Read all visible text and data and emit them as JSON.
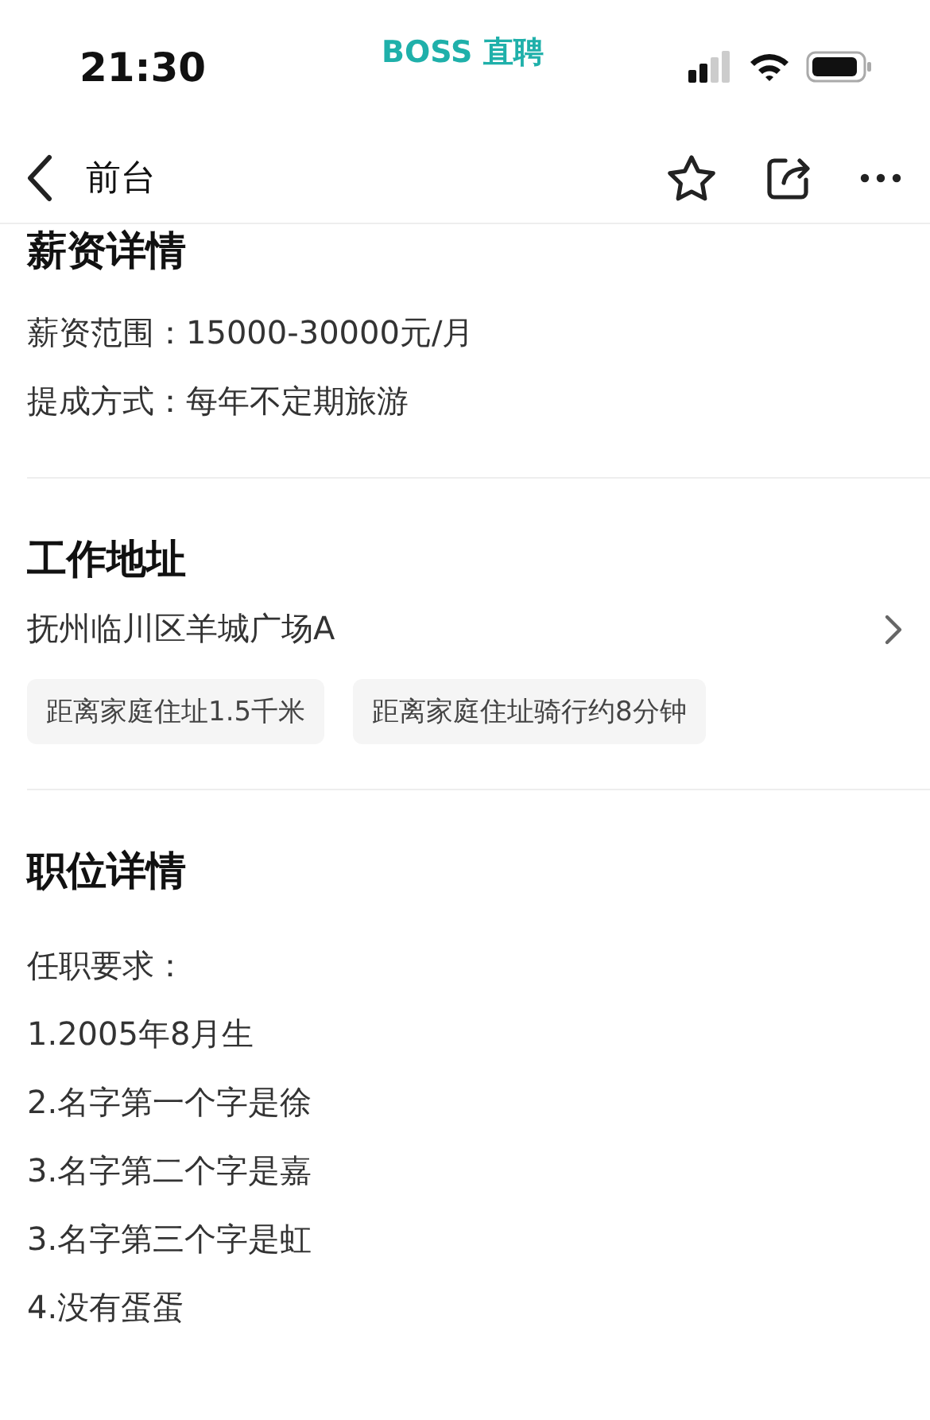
{
  "status_bar": {
    "time": "21:30",
    "app_label": "BOSS 直聘"
  },
  "nav": {
    "title": "前台"
  },
  "sections": [
    {
      "kind": "text",
      "title": "薪资详情",
      "lines": [
        "薪资范围：15000-30000元/月",
        "提成方式：每年不定期旅游"
      ]
    },
    {
      "kind": "address",
      "title": "工作地址",
      "address": "抚州临川区羊城广场A",
      "tags": [
        "距离家庭住址1.5千米",
        "距离家庭住址骑行约8分钟"
      ]
    },
    {
      "kind": "text",
      "title": "职位详情",
      "lines": [
        "任职要求：",
        "1.2005年8月生",
        "2.名字第一个字是徐",
        "3.名字第二个字是嘉",
        "3.名字第三个字是虹",
        "4.没有蛋蛋"
      ]
    }
  ]
}
